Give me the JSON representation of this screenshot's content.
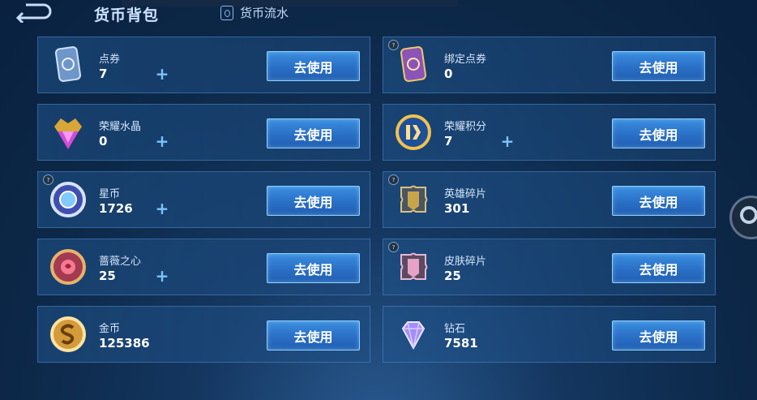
{
  "header": {
    "title": "货币背包",
    "flow_label": "货币流水"
  },
  "currencies": [
    {
      "name": "点券",
      "value": "7",
      "has_plus": true,
      "has_info": false,
      "button": "去使用",
      "icon": "coupon-card-icon"
    },
    {
      "name": "绑定点券",
      "value": "0",
      "has_plus": false,
      "has_info": true,
      "button": "去使用",
      "icon": "bound-coupon-card-icon"
    },
    {
      "name": "荣耀水晶",
      "value": "0",
      "has_plus": true,
      "has_info": false,
      "button": "去使用",
      "icon": "glory-crystal-icon"
    },
    {
      "name": "荣耀积分",
      "value": "7",
      "has_plus": true,
      "has_info": false,
      "button": "去使用",
      "icon": "glory-points-icon"
    },
    {
      "name": "星币",
      "value": "1726",
      "has_plus": true,
      "has_info": true,
      "button": "去使用",
      "icon": "star-coin-icon"
    },
    {
      "name": "英雄碎片",
      "value": "301",
      "has_plus": false,
      "has_info": true,
      "button": "去使用",
      "icon": "hero-fragment-icon"
    },
    {
      "name": "蔷薇之心",
      "value": "25",
      "has_plus": true,
      "has_info": false,
      "button": "去使用",
      "icon": "rose-heart-icon"
    },
    {
      "name": "皮肤碎片",
      "value": "25",
      "has_plus": false,
      "has_info": true,
      "button": "去使用",
      "icon": "skin-fragment-icon"
    },
    {
      "name": "金币",
      "value": "125386",
      "has_plus": false,
      "has_info": false,
      "button": "去使用",
      "icon": "gold-coin-icon"
    },
    {
      "name": "钻石",
      "value": "7581",
      "has_plus": false,
      "has_info": false,
      "button": "去使用",
      "icon": "diamond-icon"
    }
  ],
  "plus_symbol": "+",
  "info_symbol": "?"
}
